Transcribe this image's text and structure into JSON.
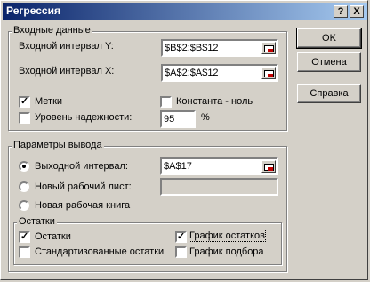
{
  "window": {
    "title": "Регрессия",
    "help_btn": "?",
    "close_btn": "X"
  },
  "input": {
    "group_label": "Входные данные",
    "y_label": "Входной интервал Y:",
    "y_value": "$B$2:$B$12",
    "x_label": "Входной интервал X:",
    "x_value": "$A$2:$A$12",
    "labels_checkbox": "Метки",
    "labels_checked": true,
    "constant_zero": "Константа - ноль",
    "confidence_label": "Уровень надежности:",
    "confidence_value": "95",
    "percent": "%"
  },
  "output": {
    "group_label": "Параметры вывода",
    "output_range_label": "Выходной интервал:",
    "output_range_value": "$A$17",
    "new_sheet_label": "Новый рабочий лист:",
    "new_sheet_value": "",
    "new_book_label": "Новая рабочая книга"
  },
  "residuals": {
    "group_label": "Остатки",
    "residuals": "Остатки",
    "residuals_checked": true,
    "residual_plot": "График остатков",
    "residual_plot_checked": true,
    "std_residuals": "Стандартизованные остатки",
    "fit_plot": "График подбора"
  },
  "buttons": {
    "ok": "OK",
    "cancel": "Отмена",
    "help": "Справка"
  }
}
